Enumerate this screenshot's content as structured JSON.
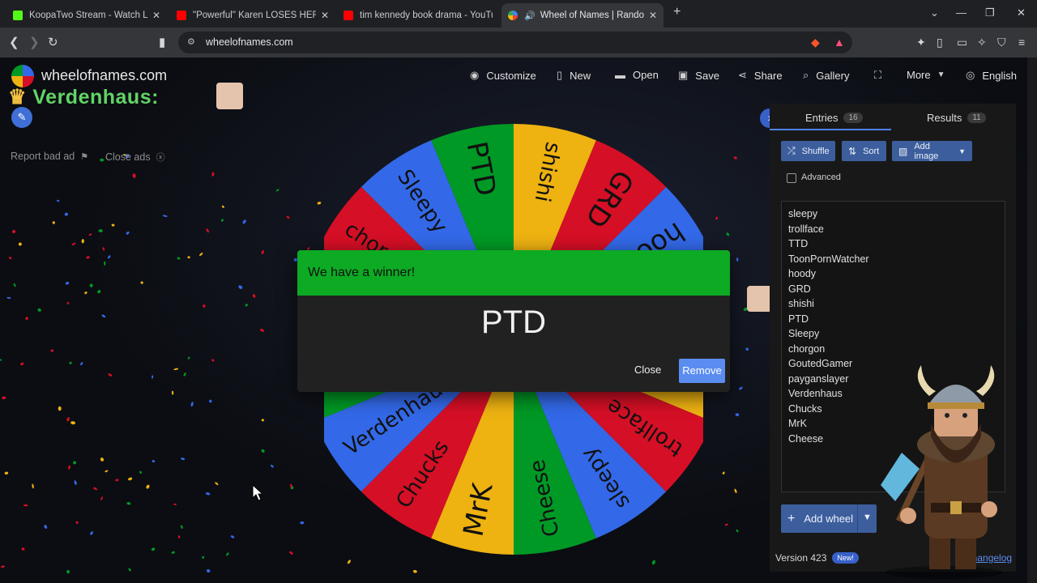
{
  "browser": {
    "tabs": [
      {
        "title": "KoopaTwo Stream - Watch Live on",
        "color": "#53fc18"
      },
      {
        "title": "\"Powerful\" Karen LOSES HER MIND W",
        "color": "#ff0000"
      },
      {
        "title": "tim kennedy book drama - YouTube",
        "color": "#ff0000"
      },
      {
        "title": "Wheel of Names | Random na",
        "color": "#4285f4"
      }
    ],
    "new_tab": "+",
    "url": "wheelofnames.com"
  },
  "site": {
    "name": "wheelofnames.com",
    "menu": {
      "customize": "Customize",
      "new": "New",
      "open": "Open",
      "save": "Save",
      "share": "Share",
      "gallery": "Gallery",
      "more": "More",
      "language": "English"
    },
    "overlay_name": "Verdenhaus:",
    "report_ad": "Report bad ad",
    "close_ads": "Close ads"
  },
  "wheel": {
    "slices": [
      {
        "label": "sleepy",
        "color": "#3369e8"
      },
      {
        "label": "trollface",
        "color": "#d50f25"
      },
      {
        "label": "TTD",
        "color": "#eeb211"
      },
      {
        "label": "ToonPornWatcher",
        "color": "#009925"
      },
      {
        "label": "hoody",
        "color": "#3369e8"
      },
      {
        "label": "GRD",
        "color": "#d50f25"
      },
      {
        "label": "shishi",
        "color": "#eeb211"
      },
      {
        "label": "PTD",
        "color": "#009925"
      },
      {
        "label": "Sleepy",
        "color": "#3369e8"
      },
      {
        "label": "chorgon",
        "color": "#d50f25"
      },
      {
        "label": "GoutedGamer",
        "color": "#eeb211"
      },
      {
        "label": "payganslayer",
        "color": "#009925"
      },
      {
        "label": "Verdenhaus",
        "color": "#3369e8"
      },
      {
        "label": "Chucks",
        "color": "#d50f25"
      },
      {
        "label": "MrK",
        "color": "#eeb211"
      },
      {
        "label": "Cheese",
        "color": "#009925"
      }
    ]
  },
  "modal": {
    "title": "We have a winner!",
    "winner": "PTD",
    "close": "Close",
    "remove": "Remove"
  },
  "sidebar": {
    "entries_tab": "Entries",
    "entries_count": "16",
    "results_tab": "Results",
    "results_count": "11",
    "shuffle": "Shuffle",
    "sort": "Sort",
    "add_image": "Add image",
    "advanced": "Advanced",
    "entries": [
      "sleepy",
      "trollface",
      "TTD",
      "ToonPornWatcher",
      "hoody",
      "GRD",
      "shishi",
      "PTD",
      "Sleepy",
      "chorgon",
      "GoutedGamer",
      "payganslayer",
      "Verdenhaus",
      "Chucks",
      "MrK",
      "Cheese"
    ],
    "add_wheel": "Add wheel",
    "version": "Version 423",
    "new_badge": "New!",
    "changelog": "Changelog"
  }
}
